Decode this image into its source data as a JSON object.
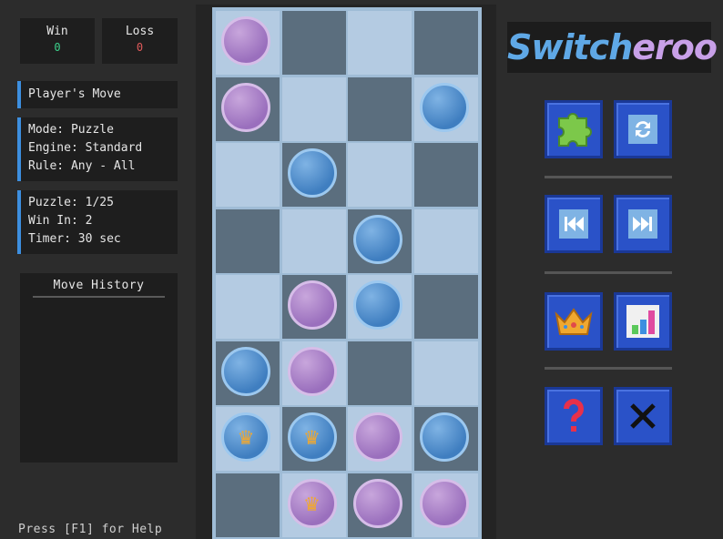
{
  "score": {
    "win_label": "Win",
    "win_value": "0",
    "loss_label": "Loss",
    "loss_value": "0"
  },
  "status": {
    "turn": "Player's Move"
  },
  "settings": {
    "mode": "Mode: Puzzle",
    "engine": "Engine: Standard",
    "rule": "Rule: Any - All"
  },
  "puzzle": {
    "puzzle": "Puzzle: 1/25",
    "win_in": "Win In: 2",
    "timer": "Timer: 30 sec"
  },
  "history": {
    "title": "Move History"
  },
  "help": {
    "text": "Press [F1] for Help"
  },
  "logo": {
    "part1": "Switch",
    "part2": "eroo"
  },
  "colors": {
    "win": "#3cd28c",
    "loss": "#e05a5a",
    "accent": "#3d8fe0",
    "purple": "#9a6fbd",
    "blue": "#3f7ec0"
  },
  "board": {
    "rows": [
      [
        "purple",
        null,
        null,
        null
      ],
      [
        "purple",
        null,
        null,
        "blue"
      ],
      [
        null,
        "blue",
        null,
        null
      ],
      [
        null,
        null,
        "blue",
        null
      ],
      [
        null,
        "purple",
        "blue",
        null
      ],
      [
        "blue",
        "purple",
        null,
        null
      ],
      [
        "blue-king",
        "blue-king",
        "purple",
        "blue"
      ],
      [
        null,
        "purple-king",
        "purple",
        "purple"
      ]
    ]
  },
  "buttons": [
    "puzzle-icon",
    "refresh-icon",
    "rewind-icon",
    "fast-forward-icon",
    "crown-icon",
    "stats-icon",
    "help-icon",
    "close-icon"
  ]
}
